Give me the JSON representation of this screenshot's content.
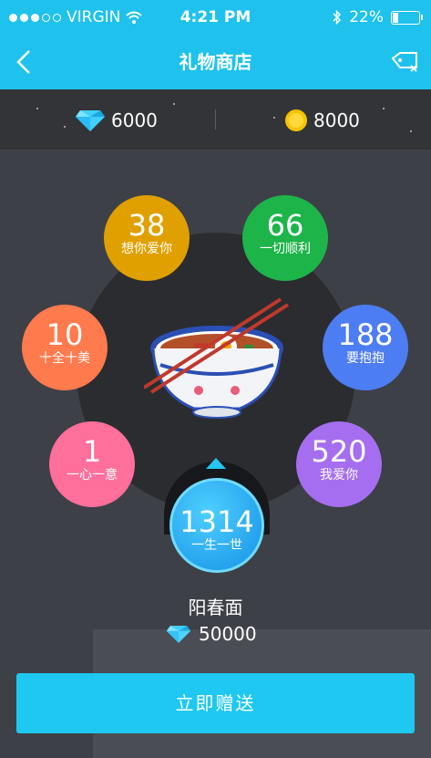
{
  "status_bar": {
    "carrier": "VIRGIN",
    "time": "4:21 PM",
    "battery": "22%"
  },
  "nav": {
    "title": "礼物商店"
  },
  "balance": {
    "diamonds": "6000",
    "coins": "8000"
  },
  "gifts": [
    {
      "value": "38",
      "label": "想你爱你",
      "color": "#e0a000"
    },
    {
      "value": "66",
      "label": "一切顺利",
      "color": "#1db44a"
    },
    {
      "value": "10",
      "label": "十全十美",
      "color": "#ff7a4d"
    },
    {
      "value": "188",
      "label": "要抱抱",
      "color": "#4d7df2"
    },
    {
      "value": "1",
      "label": "一心一意",
      "color": "#ff6f9c"
    },
    {
      "value": "520",
      "label": "我爱你",
      "color": "#a56ef0"
    },
    {
      "value": "1314",
      "label": "一生一世",
      "color": "#1aa9f0"
    }
  ],
  "selected_item": {
    "name": "阳春面",
    "price": "50000"
  },
  "send_button": "立即赠送"
}
